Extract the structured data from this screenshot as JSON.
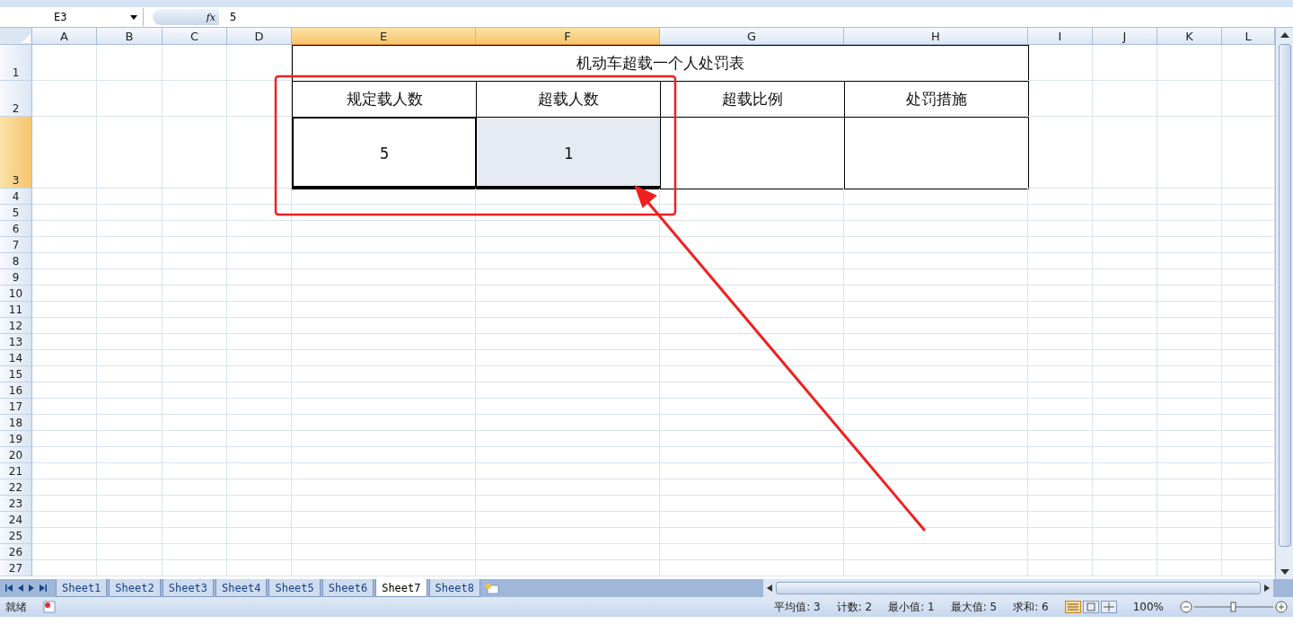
{
  "formula_bar": {
    "name_box": "E3",
    "function_label": "fx",
    "value": "5"
  },
  "columns": [
    {
      "label": "A",
      "selected": false
    },
    {
      "label": "B",
      "selected": false
    },
    {
      "label": "C",
      "selected": false
    },
    {
      "label": "D",
      "selected": false
    },
    {
      "label": "E",
      "selected": true
    },
    {
      "label": "F",
      "selected": true
    },
    {
      "label": "G",
      "selected": false
    },
    {
      "label": "H",
      "selected": false
    },
    {
      "label": "I",
      "selected": false
    },
    {
      "label": "J",
      "selected": false
    },
    {
      "label": "K",
      "selected": false
    },
    {
      "label": "L",
      "selected": false
    }
  ],
  "rows": [
    {
      "label": "1",
      "selected": false
    },
    {
      "label": "2",
      "selected": false
    },
    {
      "label": "3",
      "selected": true
    },
    {
      "label": "4",
      "selected": false
    },
    {
      "label": "5",
      "selected": false
    },
    {
      "label": "6",
      "selected": false
    },
    {
      "label": "7",
      "selected": false
    },
    {
      "label": "8",
      "selected": false
    },
    {
      "label": "9",
      "selected": false
    },
    {
      "label": "10",
      "selected": false
    },
    {
      "label": "11",
      "selected": false
    },
    {
      "label": "12",
      "selected": false
    },
    {
      "label": "13",
      "selected": false
    },
    {
      "label": "14",
      "selected": false
    },
    {
      "label": "15",
      "selected": false
    },
    {
      "label": "16",
      "selected": false
    },
    {
      "label": "17",
      "selected": false
    },
    {
      "label": "18",
      "selected": false
    },
    {
      "label": "19",
      "selected": false
    },
    {
      "label": "20",
      "selected": false
    },
    {
      "label": "21",
      "selected": false
    },
    {
      "label": "22",
      "selected": false
    },
    {
      "label": "23",
      "selected": false
    },
    {
      "label": "24",
      "selected": false
    },
    {
      "label": "25",
      "selected": false
    },
    {
      "label": "26",
      "selected": false
    },
    {
      "label": "27",
      "selected": false
    }
  ],
  "table": {
    "title": "机动车超载一个人处罚表",
    "headers": [
      "规定载人数",
      "超载人数",
      "超载比例",
      "处罚措施"
    ],
    "values": [
      {
        "text": "5",
        "selected": true,
        "active": true
      },
      {
        "text": "1",
        "selected": true,
        "active": false
      }
    ]
  },
  "sheet_tabs": [
    {
      "label": "Sheet1",
      "selected": false
    },
    {
      "label": "Sheet2",
      "selected": false
    },
    {
      "label": "Sheet3",
      "selected": false
    },
    {
      "label": "Sheet4",
      "selected": false
    },
    {
      "label": "Sheet5",
      "selected": false
    },
    {
      "label": "Sheet6",
      "selected": false
    },
    {
      "label": "Sheet7",
      "selected": true
    },
    {
      "label": "Sheet8",
      "selected": false
    }
  ],
  "status_bar": {
    "mode": "就绪",
    "stats": [
      "平均值: 3",
      "计数: 2",
      "最小值: 1",
      "最大值: 5",
      "求和: 6"
    ],
    "zoom": "100%"
  }
}
